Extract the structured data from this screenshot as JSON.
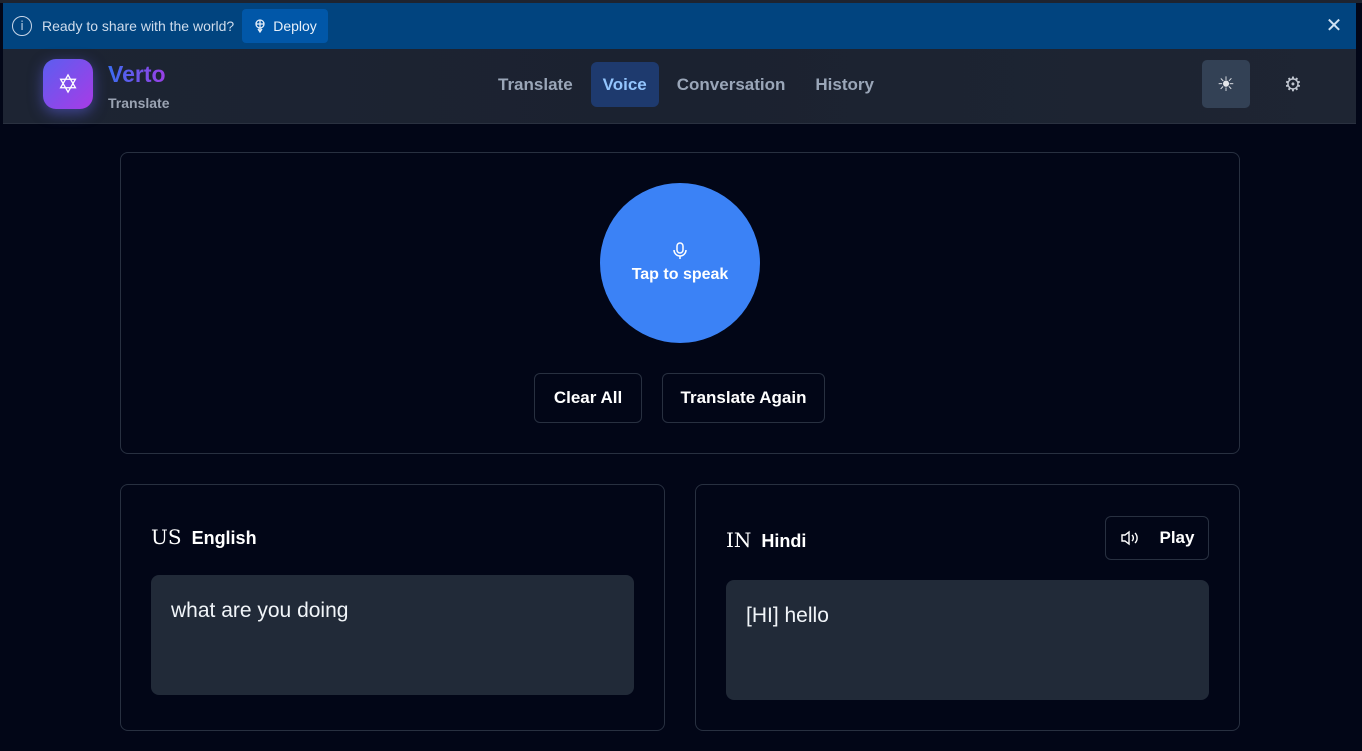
{
  "banner": {
    "message": "Ready to share with the world?",
    "deploy_label": "Deploy",
    "info_icon": "info-icon",
    "close_icon": "close-icon"
  },
  "header": {
    "brand": "Verto",
    "subtitle": "Translate",
    "nav": [
      {
        "label": "Translate",
        "active": false
      },
      {
        "label": "Voice",
        "active": true
      },
      {
        "label": "Conversation",
        "active": false
      },
      {
        "label": "History",
        "active": false
      }
    ]
  },
  "voice": {
    "mic_label": "Tap to speak",
    "clear_label": "Clear All",
    "translate_again_label": "Translate Again"
  },
  "source": {
    "code": "US",
    "language": "English",
    "text": "what are you doing"
  },
  "target": {
    "code": "IN",
    "language": "Hindi",
    "text": "[HI] hello",
    "play_label": "Play"
  },
  "colors": {
    "accent": "#3b82f6",
    "banner": "#01447f",
    "background": "#020617"
  }
}
